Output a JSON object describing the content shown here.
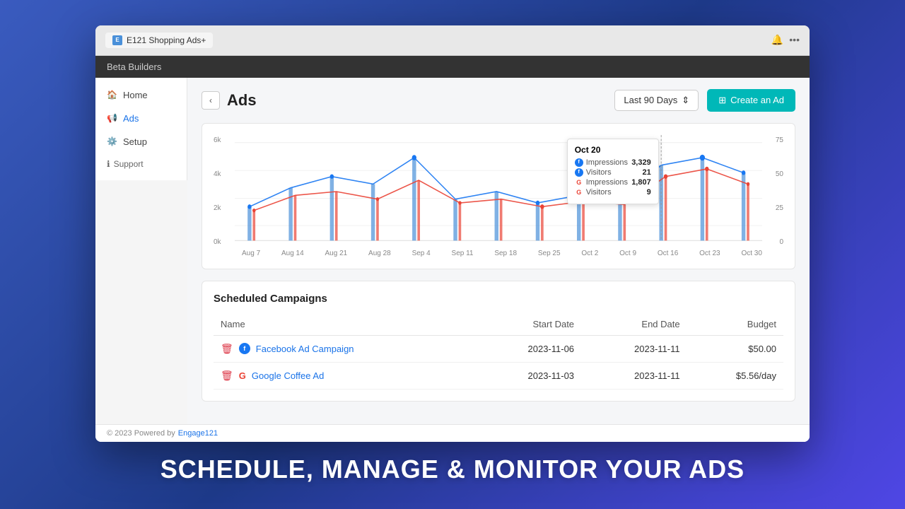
{
  "browser": {
    "tab_icon": "E",
    "tab_title": "E121 Shopping Ads+",
    "bell_icon": "🔔",
    "more_icon": "···"
  },
  "app": {
    "top_bar": "Beta Builders"
  },
  "sidebar": {
    "items": [
      {
        "id": "home",
        "label": "Home",
        "icon": "🏠",
        "active": false
      },
      {
        "id": "ads",
        "label": "Ads",
        "icon": "📢",
        "active": true
      },
      {
        "id": "setup",
        "label": "Setup",
        "icon": "⚙️",
        "active": false
      }
    ],
    "support_label": "Support",
    "footer_text": "© 2023 Powered by",
    "footer_link": "Engage121"
  },
  "header": {
    "back_icon": "‹",
    "page_title": "Ads",
    "date_filter": "Last 90 Days",
    "date_filter_icon": "⇕",
    "create_ad_label": "Create an Ad",
    "create_ad_icon": "+"
  },
  "chart": {
    "y_left_labels": [
      "6k",
      "4k",
      "2k",
      "0k"
    ],
    "y_right_labels": [
      "75",
      "50",
      "25",
      "0"
    ],
    "x_labels": [
      "Aug 7",
      "Aug 14",
      "Aug 21",
      "Aug 28",
      "Sep 4",
      "Sep 11",
      "Sep 18",
      "Sep 25",
      "Oct 2",
      "Oct 9",
      "Oct 16",
      "Oct 23",
      "Oct 30"
    ],
    "tooltip": {
      "date": "Oct 20",
      "rows": [
        {
          "platform": "fb",
          "metric": "Impressions",
          "value": "3,329"
        },
        {
          "platform": "fb",
          "metric": "Visitors",
          "value": "21"
        },
        {
          "platform": "g",
          "metric": "Impressions",
          "value": "1,807"
        },
        {
          "platform": "g",
          "metric": "Visitors",
          "value": "9"
        }
      ]
    }
  },
  "campaigns": {
    "title": "Scheduled Campaigns",
    "columns": [
      {
        "id": "name",
        "label": "Name"
      },
      {
        "id": "start_date",
        "label": "Start Date"
      },
      {
        "id": "end_date",
        "label": "End Date"
      },
      {
        "id": "budget",
        "label": "Budget"
      }
    ],
    "rows": [
      {
        "id": 1,
        "platform": "fb",
        "name": "Facebook Ad Campaign",
        "start_date": "2023-11-06",
        "end_date": "2023-11-11",
        "budget": "$50.00"
      },
      {
        "id": 2,
        "platform": "g",
        "name": "Google Coffee Ad",
        "start_date": "2023-11-03",
        "end_date": "2023-11-11",
        "budget": "$5.56/day"
      }
    ]
  },
  "footer": {
    "text": "© 2023 Powered by",
    "link_label": "Engage121"
  },
  "tagline": "Schedule, Manage & Monitor Your Ads",
  "colors": {
    "accent_teal": "#00b8b8",
    "fb_blue": "#1877f2",
    "google_red": "#ea4335",
    "active_nav": "#1a73e8"
  }
}
